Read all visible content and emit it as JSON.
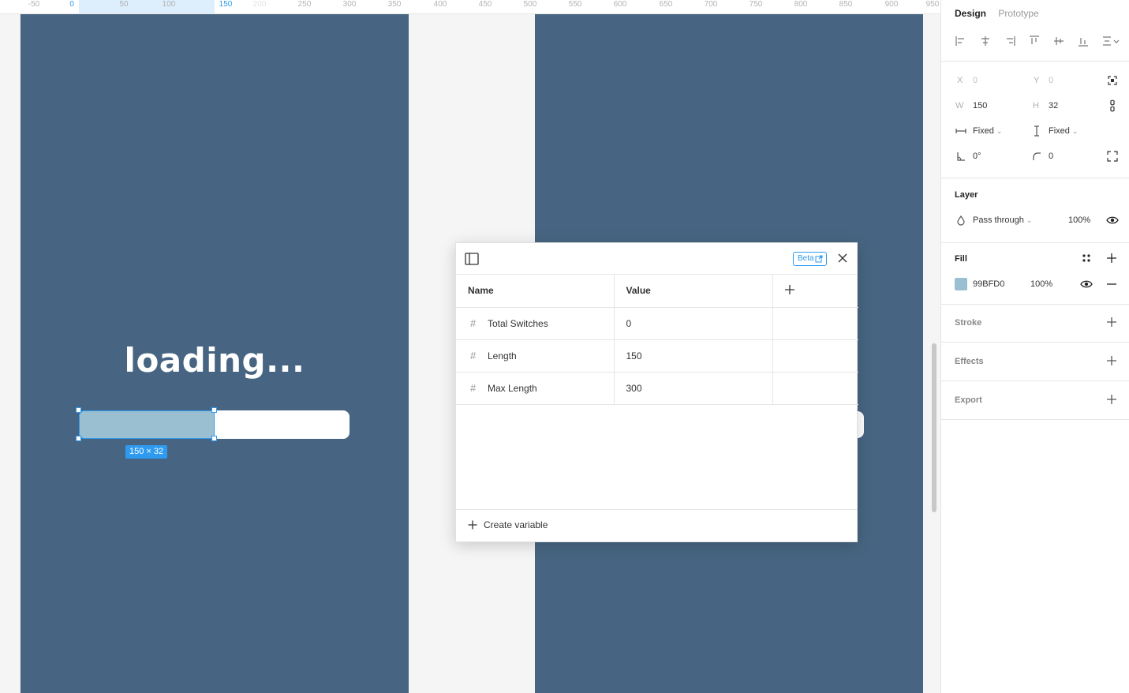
{
  "ruler": {
    "ticks": [
      "-50",
      "0",
      "50",
      "100",
      "150",
      "200",
      "250",
      "300",
      "350",
      "400",
      "450",
      "500",
      "550",
      "600",
      "650",
      "700",
      "750",
      "800",
      "850",
      "900",
      "950"
    ]
  },
  "canvas": {
    "loading_text": "loading...",
    "selection_size": "150 × 32",
    "frame_color": "#476582",
    "bar_fill_color": "#99BFD0",
    "selection_color": "#2E9BF0"
  },
  "variables_modal": {
    "beta_label": "Beta",
    "columns": {
      "name": "Name",
      "value": "Value"
    },
    "rows": [
      {
        "name": "Total Switches",
        "value": "0"
      },
      {
        "name": "Length",
        "value": "150"
      },
      {
        "name": "Max Length",
        "value": "300"
      }
    ],
    "create_label": "Create variable"
  },
  "panel": {
    "tabs": {
      "design": "Design",
      "prototype": "Prototype"
    },
    "x_label": "X",
    "x_value": "0",
    "y_label": "Y",
    "y_value": "0",
    "w_label": "W",
    "w_value": "150",
    "h_label": "H",
    "h_value": "32",
    "h_sizing": "Fixed",
    "v_sizing": "Fixed",
    "rotation": "0°",
    "radius": "0",
    "layer_title": "Layer",
    "blend_mode": "Pass through",
    "layer_opacity": "100%",
    "fill_title": "Fill",
    "fill_hex": "99BFD0",
    "fill_opacity": "100%",
    "stroke_title": "Stroke",
    "effects_title": "Effects",
    "export_title": "Export"
  }
}
